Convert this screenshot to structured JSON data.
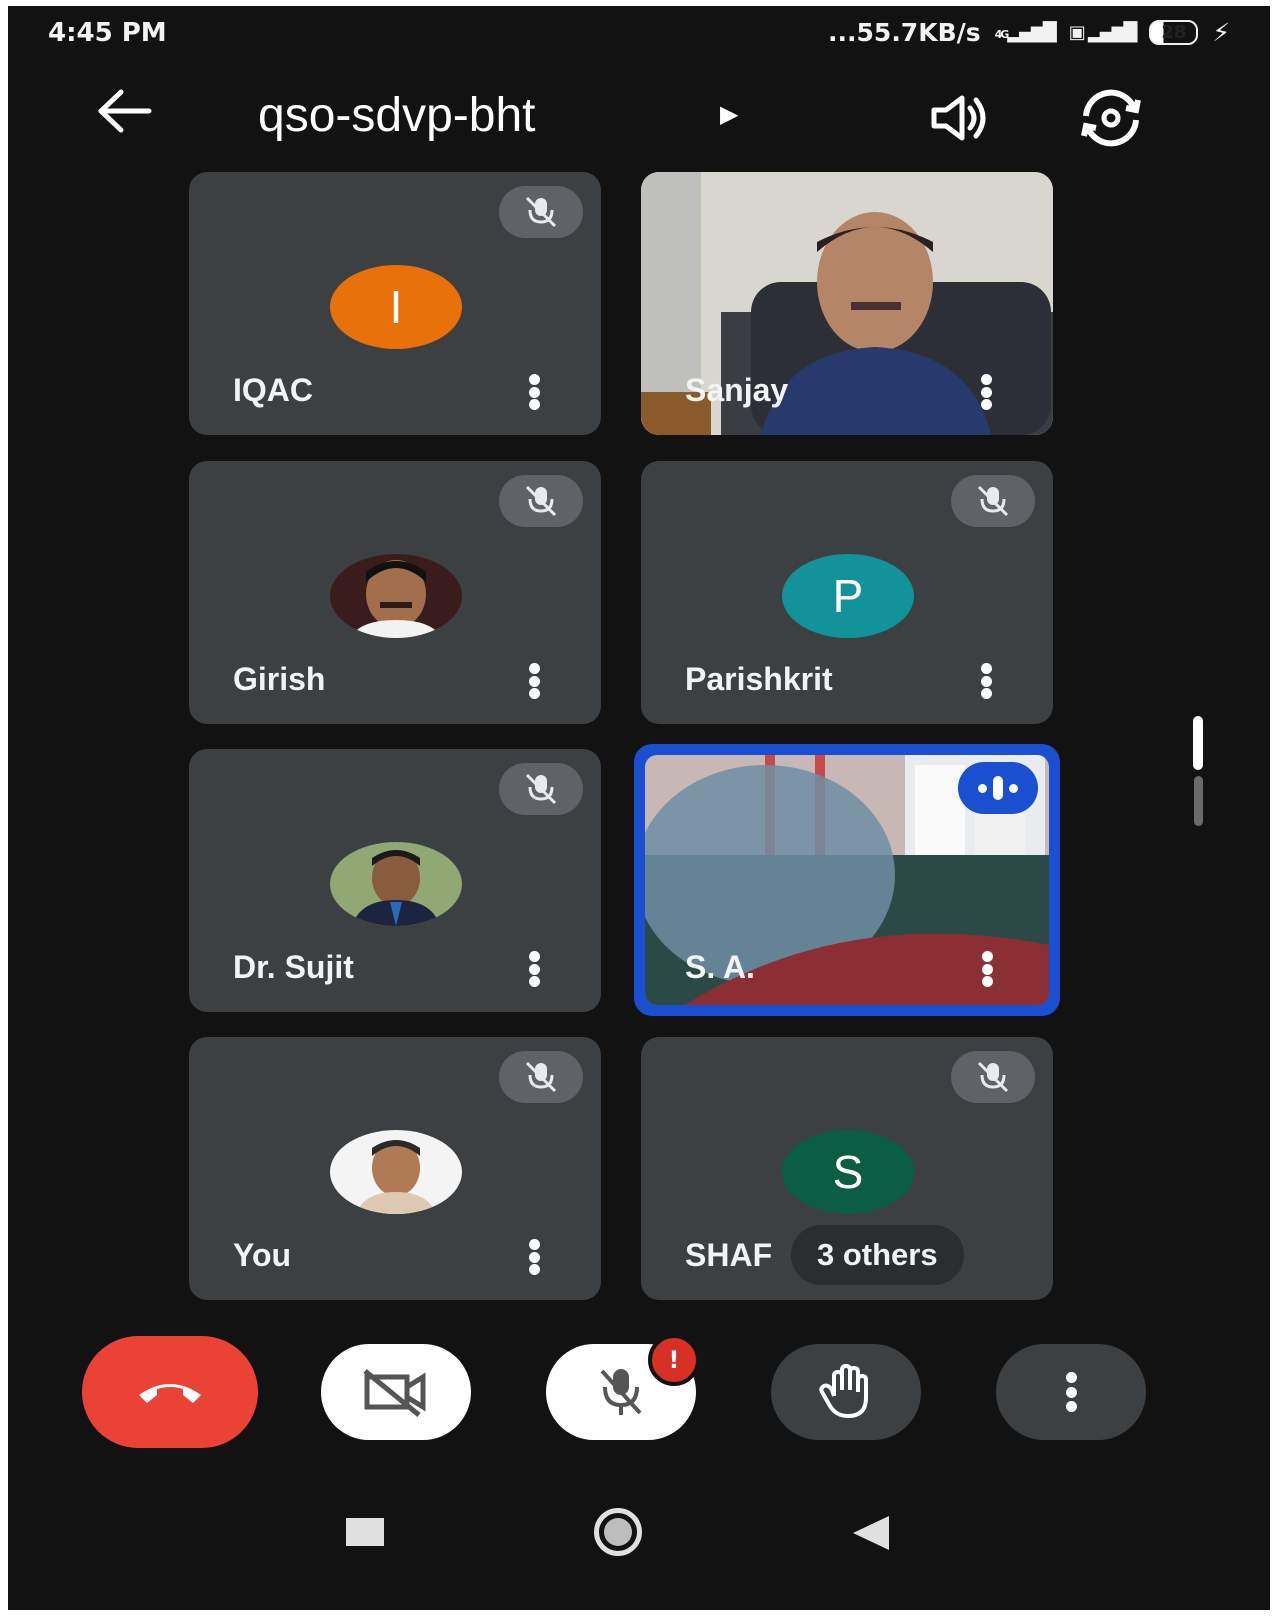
{
  "status_bar": {
    "time": "4:45 PM",
    "net_speed": "...55.7KB/s",
    "network_label": "4G",
    "battery": "28"
  },
  "header": {
    "meeting_code": "qso-sdvp-bht"
  },
  "tiles": [
    {
      "name": "IQAC",
      "avatar_letter": "I",
      "avatar_color": "#e8710a",
      "muted": true
    },
    {
      "name": "Sanjay",
      "video": true,
      "muted": false
    },
    {
      "name": "Girish",
      "avatar_photo": true,
      "muted": true
    },
    {
      "name": "Parishkrit",
      "avatar_letter": "P",
      "avatar_color": "#12939a",
      "muted": true
    },
    {
      "name": "Dr. Sujit",
      "avatar_photo": true,
      "muted": true
    },
    {
      "name": "S. A.",
      "video": true,
      "speaking": true,
      "highlight_color": "#1a4fd1"
    },
    {
      "name": "You",
      "avatar_photo": true,
      "muted": true
    },
    {
      "name": "SHAF",
      "avatar_letter": "S",
      "avatar_color": "#0b5e43",
      "muted": true,
      "others_label": "3 others"
    }
  ],
  "controls": {
    "end_call_color": "#ea4335",
    "mic_alert": "!"
  },
  "icons": [
    "back-arrow-icon",
    "speaker-icon",
    "flip-camera-icon",
    "mic-off-icon",
    "more-vert-icon",
    "end-call-icon",
    "camera-off-icon",
    "raise-hand-icon",
    "square-nav-icon",
    "home-nav-icon",
    "back-nav-icon"
  ]
}
